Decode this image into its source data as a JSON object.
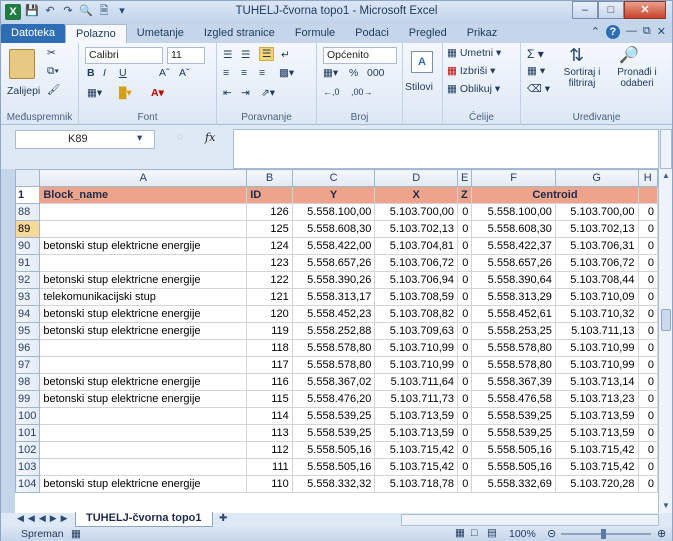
{
  "window": {
    "title": "TUHELJ-čvorna topo1 - Microsoft Excel",
    "minimize": "–",
    "maximize": "□",
    "close": "✕"
  },
  "tabs": [
    {
      "label": "Datoteka"
    },
    {
      "label": "Polazno"
    },
    {
      "label": "Umetanje"
    },
    {
      "label": "Izgled stranice"
    },
    {
      "label": "Formule"
    },
    {
      "label": "Podaci"
    },
    {
      "label": "Pregled"
    },
    {
      "label": "Prikaz"
    }
  ],
  "ribbon": {
    "clipboard": {
      "paste": "Zalijepi",
      "label": "Međuspremnik"
    },
    "font": {
      "name": "Calibri",
      "size": "11",
      "label": "Font"
    },
    "alignment": {
      "label": "Poravnanje"
    },
    "number": {
      "format": "Općenito",
      "label": "Broj"
    },
    "styles": {
      "label": "Stilovi"
    },
    "cells": {
      "insert": "Umetni",
      "delete": "Izbriši",
      "format": "Oblikuj",
      "label": "Ćelije"
    },
    "editing": {
      "sort": "Sortiraj i filtriraj",
      "find": "Pronađi i odaberi",
      "label": "Uređivanje"
    }
  },
  "formula_bar": {
    "name_box": "K89",
    "fx": "fx",
    "content": ""
  },
  "columns": [
    "A",
    "B",
    "C",
    "D",
    "E",
    "F",
    "G",
    "H"
  ],
  "header_row": {
    "row": "1",
    "A": "Block_name",
    "B": "ID",
    "C": "Y",
    "D": "X",
    "E": "Z",
    "FG": "Centroid",
    "H": ""
  },
  "rows": [
    {
      "row": "88",
      "A": "",
      "B": "126",
      "C": "5.558.100,00",
      "D": "5.103.700,00",
      "E": "0",
      "F": "5.558.100,00",
      "G": "5.103.700,00",
      "H": "0"
    },
    {
      "row": "89",
      "A": "",
      "B": "125",
      "C": "5.558.608,30",
      "D": "5.103.702,13",
      "E": "0",
      "F": "5.558.608,30",
      "G": "5.103.702,13",
      "H": "0"
    },
    {
      "row": "90",
      "A": "betonski stup elektricne energije",
      "B": "124",
      "C": "5.558.422,00",
      "D": "5.103.704,81",
      "E": "0",
      "F": "5.558.422,37",
      "G": "5.103.706,31",
      "H": "0"
    },
    {
      "row": "91",
      "A": "",
      "B": "123",
      "C": "5.558.657,26",
      "D": "5.103.706,72",
      "E": "0",
      "F": "5.558.657,26",
      "G": "5.103.706,72",
      "H": "0"
    },
    {
      "row": "92",
      "A": "betonski stup elektricne energije",
      "B": "122",
      "C": "5.558.390,26",
      "D": "5.103.706,94",
      "E": "0",
      "F": "5.558.390,64",
      "G": "5.103.708,44",
      "H": "0"
    },
    {
      "row": "93",
      "A": "telekomunikacijski stup",
      "B": "121",
      "C": "5.558.313,17",
      "D": "5.103.708,59",
      "E": "0",
      "F": "5.558.313,29",
      "G": "5.103.710,09",
      "H": "0"
    },
    {
      "row": "94",
      "A": "betonski stup elektricne energije",
      "B": "120",
      "C": "5.558.452,23",
      "D": "5.103.708,82",
      "E": "0",
      "F": "5.558.452,61",
      "G": "5.103.710,32",
      "H": "0"
    },
    {
      "row": "95",
      "A": "betonski stup elektricne energije",
      "B": "119",
      "C": "5.558.252,88",
      "D": "5.103.709,63",
      "E": "0",
      "F": "5.558.253,25",
      "G": "5.103.711,13",
      "H": "0"
    },
    {
      "row": "96",
      "A": "",
      "B": "118",
      "C": "5.558.578,80",
      "D": "5.103.710,99",
      "E": "0",
      "F": "5.558.578,80",
      "G": "5.103.710,99",
      "H": "0"
    },
    {
      "row": "97",
      "A": "",
      "B": "117",
      "C": "5.558.578,80",
      "D": "5.103.710,99",
      "E": "0",
      "F": "5.558.578,80",
      "G": "5.103.710,99",
      "H": "0"
    },
    {
      "row": "98",
      "A": "betonski stup elektricne energije",
      "B": "116",
      "C": "5.558.367,02",
      "D": "5.103.711,64",
      "E": "0",
      "F": "5.558.367,39",
      "G": "5.103.713,14",
      "H": "0"
    },
    {
      "row": "99",
      "A": "betonski stup elektricne energije",
      "B": "115",
      "C": "5.558.476,20",
      "D": "5.103.711,73",
      "E": "0",
      "F": "5.558.476,58",
      "G": "5.103.713,23",
      "H": "0"
    },
    {
      "row": "100",
      "A": "",
      "B": "114",
      "C": "5.558.539,25",
      "D": "5.103.713,59",
      "E": "0",
      "F": "5.558.539,25",
      "G": "5.103.713,59",
      "H": "0"
    },
    {
      "row": "101",
      "A": "",
      "B": "113",
      "C": "5.558.539,25",
      "D": "5.103.713,59",
      "E": "0",
      "F": "5.558.539,25",
      "G": "5.103.713,59",
      "H": "0"
    },
    {
      "row": "102",
      "A": "",
      "B": "112",
      "C": "5.558.505,16",
      "D": "5.103.715,42",
      "E": "0",
      "F": "5.558.505,16",
      "G": "5.103.715,42",
      "H": "0"
    },
    {
      "row": "103",
      "A": "",
      "B": "111",
      "C": "5.558.505,16",
      "D": "5.103.715,42",
      "E": "0",
      "F": "5.558.505,16",
      "G": "5.103.715,42",
      "H": "0"
    },
    {
      "row": "104",
      "A": "betonski stup elektricne energije",
      "B": "110",
      "C": "5.558.332,32",
      "D": "5.103.718,78",
      "E": "0",
      "F": "5.558.332,69",
      "G": "5.103.720,28",
      "H": "0"
    }
  ],
  "sheet": {
    "name": "TUHELJ-čvorna topo1"
  },
  "status": {
    "text": "Spreman",
    "zoom": "100%"
  }
}
